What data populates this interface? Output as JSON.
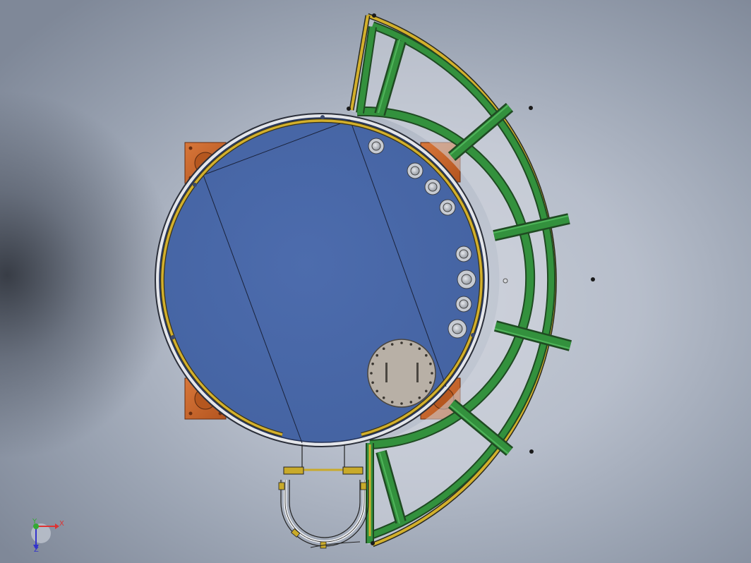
{
  "viewport": {
    "background": "#b7becb",
    "colors": {
      "tank_fill": "#4a69a8",
      "ring_yellow": "#c9aa2a",
      "frame_green": "#2f8a3a",
      "base_plate": "#c9662c",
      "manhole": "#b8b0a6",
      "nozzle": "#a9aeb6"
    }
  },
  "triad": {
    "x_label": "X",
    "y_label": "Y",
    "z_label": "Z"
  }
}
